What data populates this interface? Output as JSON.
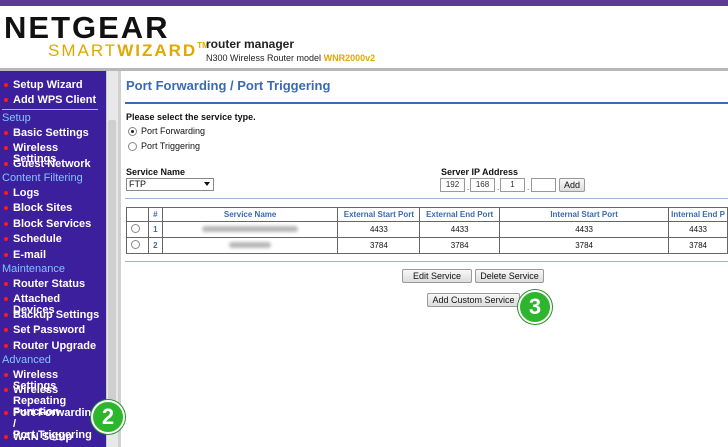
{
  "header": {
    "logo_main": "NETGEAR",
    "logo_smart": "SMART",
    "logo_wizard": "WIZARD",
    "logo_tm": "TM",
    "title": "router manager",
    "subtitle": "N300 Wireless Router",
    "model_label": "model",
    "model": "WNR2000v2"
  },
  "sidebar": {
    "setup_wizard": "Setup Wizard",
    "add_wps": "Add WPS Client",
    "setup_head": "Setup",
    "basic_settings": "Basic Settings",
    "wireless_settings": "Wireless Settings",
    "guest_network": "Guest Network",
    "content_filtering_head": "Content Filtering",
    "logs": "Logs",
    "block_sites": "Block Sites",
    "block_services": "Block Services",
    "schedule": "Schedule",
    "email": "E-mail",
    "maintenance_head": "Maintenance",
    "router_status": "Router Status",
    "attached_devices": "Attached Devices",
    "backup_settings": "Backup Settings",
    "set_password": "Set Password",
    "router_upgrade": "Router Upgrade",
    "advanced_head": "Advanced",
    "wireless_settings_adv": "Wireless Settings",
    "wireless_repeating_1": "Wireless Repeating",
    "wireless_repeating_2": "Function",
    "port_forwarding_1": "Port Forwarding /",
    "port_forwarding_2": "Port Triggering",
    "wan_setup": "WAN Setup"
  },
  "main": {
    "title": "Port Forwarding / Port Triggering",
    "prompt": "Please select the service type.",
    "option_forwarding": "Port Forwarding",
    "option_triggering": "Port Triggering",
    "service_name_label": "Service Name",
    "service_name_value": "FTP",
    "server_ip_label": "Server IP Address",
    "ip": [
      "192",
      "168",
      "1",
      ""
    ],
    "add_button": "Add",
    "edit_button": "Edit Service",
    "delete_button": "Delete Service",
    "add_custom_button": "Add Custom Service"
  },
  "table": {
    "headers": [
      "#",
      "Service Name",
      "External Start Port",
      "External End Port",
      "Internal Start Port",
      "Internal End P"
    ],
    "rows": [
      {
        "num": "1",
        "ext_start": "4433",
        "ext_end": "4433",
        "int_start": "4433",
        "int_end": "4433"
      },
      {
        "num": "2",
        "ext_start": "3784",
        "ext_end": "3784",
        "int_start": "3784",
        "int_end": "3784"
      }
    ]
  },
  "badges": {
    "sidebar_step": "2",
    "button_step": "3"
  },
  "colors": {
    "brand_purple": "#5e3b97",
    "sidebar_bg": "#3c1f9c",
    "heading_blue": "#3b6ab0",
    "badge_green": "#2db52d",
    "logo_gold": "#e0a800"
  }
}
